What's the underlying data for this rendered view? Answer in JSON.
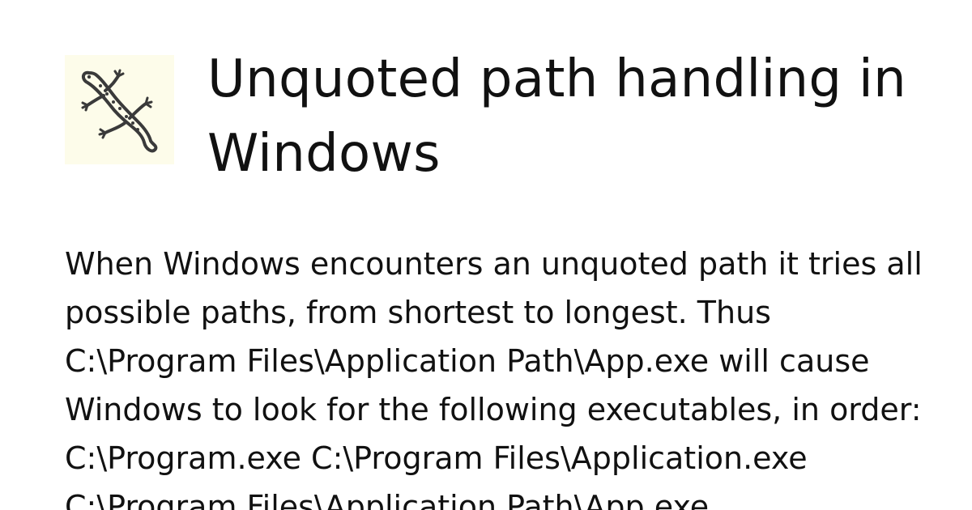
{
  "card": {
    "logo_icon": "lizard-icon",
    "logo_background": "#fdfcea",
    "title": "Unquoted path handling in Windows",
    "description": "When Windows encounters an unquoted path it tries all possible paths, from shortest to longest. Thus C:\\Program Files\\Application Path\\App.exe will cause Windows to look for the following executables, in order: C:\\Program.exe C:\\Program Files\\Application.exe C:\\Program Files\\Application Path\\App.exe"
  }
}
